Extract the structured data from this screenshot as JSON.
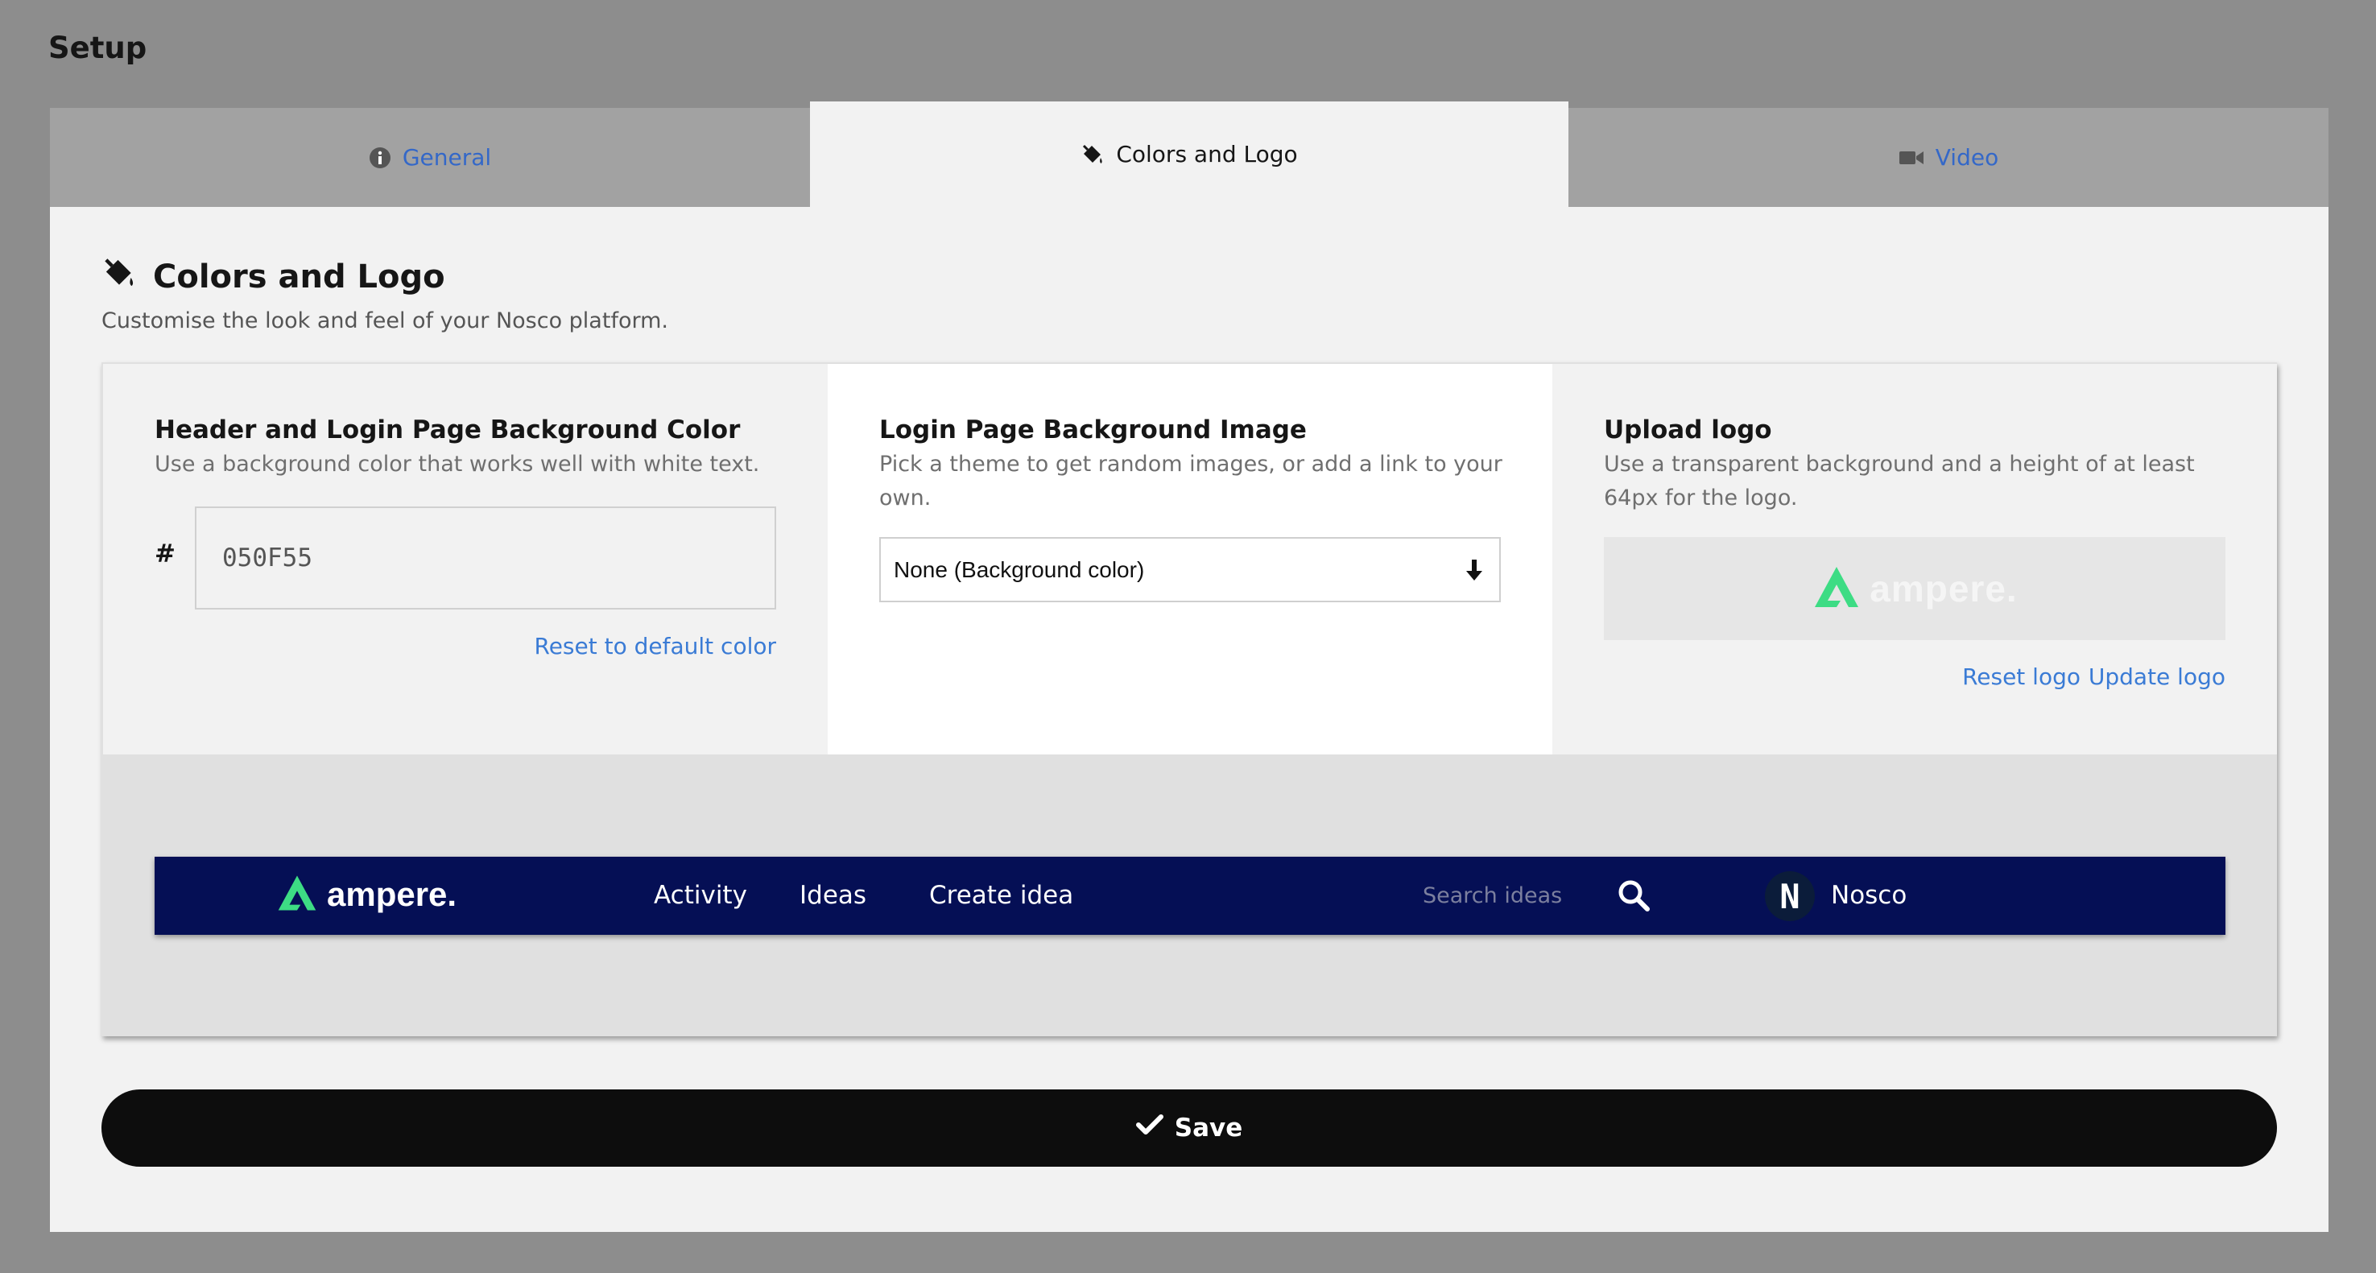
{
  "page": {
    "title": "Setup"
  },
  "tabs": [
    {
      "label": "General",
      "icon": "info-circle-icon",
      "active": false
    },
    {
      "label": "Colors and Logo",
      "icon": "paint-bucket-icon",
      "active": true
    },
    {
      "label": "Video",
      "icon": "video-camera-icon",
      "active": false
    }
  ],
  "section": {
    "title": "Colors and Logo",
    "description": "Customise the look and feel of your Nosco platform."
  },
  "header_color": {
    "title": "Header and Login Page Background Color",
    "description": "Use a background color that works well with white text.",
    "prefix": "#",
    "value": "050F55",
    "reset_link": "Reset to default color"
  },
  "background_image": {
    "title": "Login Page Background Image",
    "description": "Pick a theme to get random images, or add a link to your own.",
    "selected_option": "None (Background color)"
  },
  "upload_logo": {
    "title": "Upload logo",
    "description": "Use a transparent background and a height of at least 64px for the logo.",
    "logo_text": "ampere.",
    "reset_link": "Reset logo",
    "update_link": "Update logo"
  },
  "preview": {
    "logo_text": "ampere.",
    "nav_items": [
      "Activity",
      "Ideas",
      "Create idea"
    ],
    "search_placeholder": "Search ideas",
    "avatar_letter": "N",
    "user_name": "Nosco"
  },
  "save_button": {
    "label": "Save"
  },
  "colors": {
    "header_background": "#050f55",
    "logo_accent": "#3ddc84",
    "link": "#3a7bd5",
    "save_button": "#0d0d0d"
  }
}
